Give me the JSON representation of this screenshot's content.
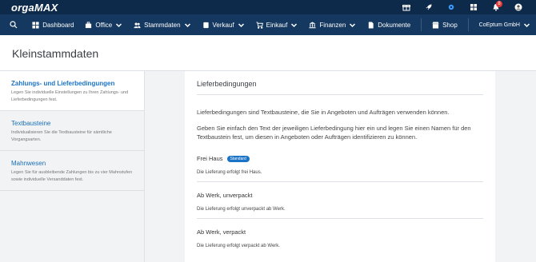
{
  "topbar": {
    "logo_orga": "orga",
    "logo_max": "MAX",
    "notification_count": "8"
  },
  "nav": {
    "items": [
      {
        "label": "Dashboard"
      },
      {
        "label": "Office"
      },
      {
        "label": "Stammdaten"
      },
      {
        "label": "Verkauf"
      },
      {
        "label": "Einkauf"
      },
      {
        "label": "Finanzen"
      },
      {
        "label": "Dokumente"
      }
    ],
    "shop": "Shop",
    "company": "CoEptum GmbH"
  },
  "page": {
    "title": "Kleinstammdaten"
  },
  "sidebar": {
    "items": [
      {
        "title": "Zahlungs- und Lieferbedingungen",
        "desc": "Legen Sie individuelle Einstellungen zu Ihren Zahlungs- und Lieferbedingungen fest."
      },
      {
        "title": "Textbausteine",
        "desc": "Individualisieren Sie die Textbausteine für sämtliche Vorgangsarten."
      },
      {
        "title": "Mahnwesen",
        "desc": "Legen Sie für ausbleibende Zahlungen bis zu vier Mahnstufen sowie individuelle Versanddaten fest."
      }
    ]
  },
  "main": {
    "heading": "Lieferbedingungen",
    "intro": "Lieferbedingungen sind Textbausteine, die Sie in Angeboten und Aufträgen verwenden können.",
    "intro2": "Geben Sie einfach den Text der jeweiligen Lieferbedingung hier ein und legen Sie einen Namen für den Textbaustein fest, um diesen in Angeboten oder Aufträgen identifizieren zu können.",
    "conditions": [
      {
        "name": "Frei Haus",
        "badge": "Standard",
        "text": "Die Lieferung erfolgt frei Haus."
      },
      {
        "name": "Ab Werk, unverpackt",
        "text": "Die Lieferung erfolgt unverpackt ab Werk."
      },
      {
        "name": "Ab Werk, verpackt",
        "text": "Die Lieferung erfolgt verpackt ab Werk."
      }
    ]
  }
}
